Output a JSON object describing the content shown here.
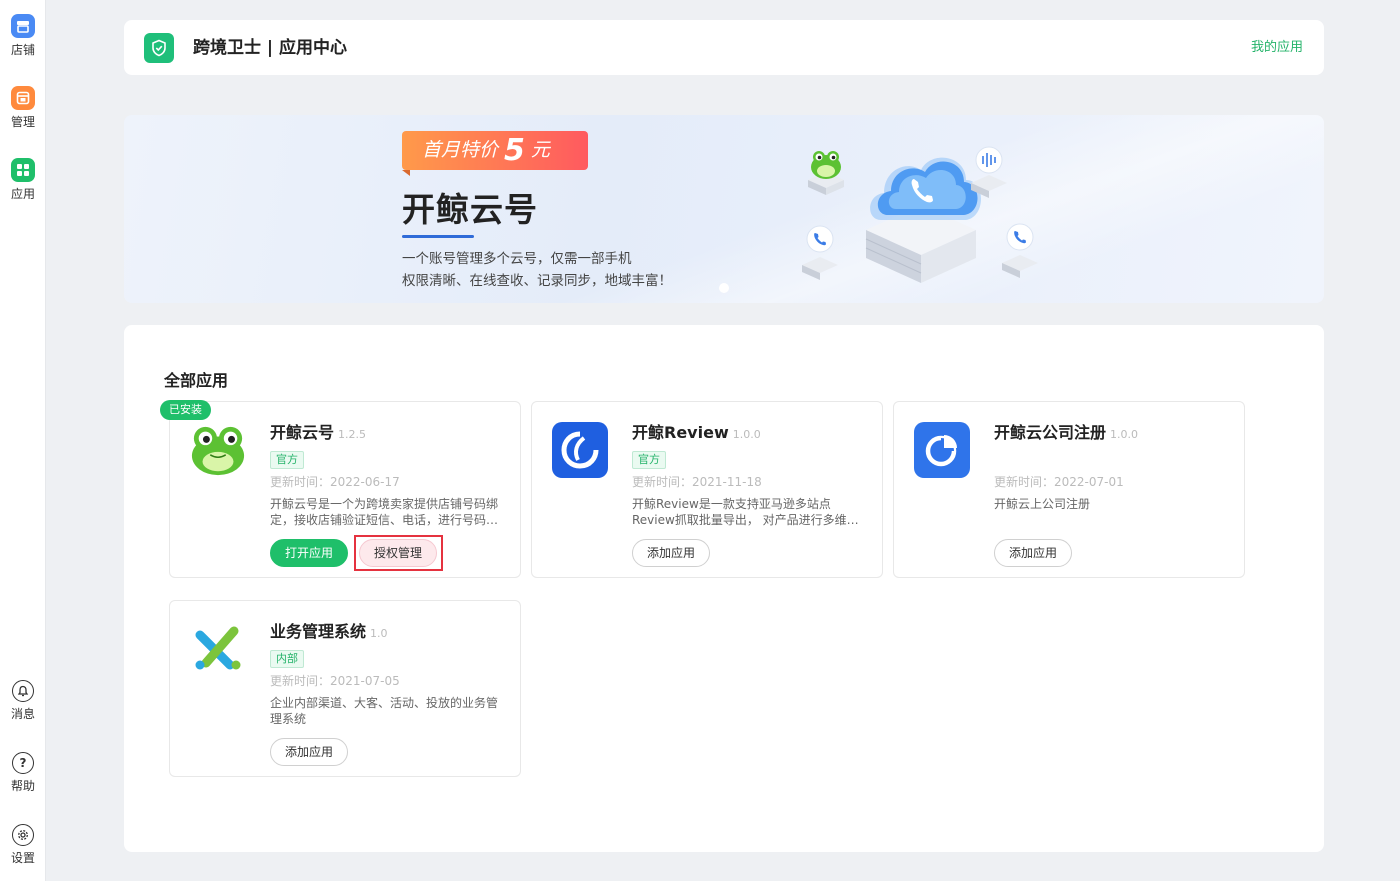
{
  "sidebar": {
    "items": [
      {
        "label": "店铺",
        "icon": "store-icon",
        "color": "#4a8af4"
      },
      {
        "label": "管理",
        "icon": "manage-icon",
        "color": "#ff8a3d"
      },
      {
        "label": "应用",
        "icon": "apps-icon",
        "color": "#1fbf6a"
      }
    ],
    "bottom_items": [
      {
        "label": "消息",
        "icon": "bell-icon"
      },
      {
        "label": "帮助",
        "icon": "help-icon"
      },
      {
        "label": "设置",
        "icon": "gear-icon"
      }
    ]
  },
  "header": {
    "title": "跨境卫士 | 应用中心",
    "my_apps": "我的应用"
  },
  "banner": {
    "promo_prefix": "首月特价",
    "promo_number": "5",
    "promo_suffix": "元",
    "title": "开鲸云号",
    "line1": "一个账号管理多个云号，仅需一部手机",
    "line2": "权限清晰、在线查收、记录同步，地域丰富！"
  },
  "apps": {
    "section_title": "全部应用",
    "installed_badge": "已安装",
    "cards": [
      {
        "name": "开鲸云号",
        "version": "1.2.5",
        "tag": "官方",
        "updated": "更新时间：2022-06-17",
        "desc": "开鲸云号是一个为跨境卖家提供店铺号码绑定，接收店铺验证短信、电话，进行号码管理的应用",
        "primary_btn": "打开应用",
        "secondary_btn": "授权管理"
      },
      {
        "name": "开鲸Review",
        "version": "1.0.0",
        "tag": "官方",
        "updated": "更新时间：2021-11-18",
        "desc": "开鲸Review是一款支持亚马逊多站点Review抓取批量导出， 对产品进行多维度分析的应用",
        "btn": "添加应用"
      },
      {
        "name": "开鲸云公司注册",
        "version": "1.0.0",
        "updated": "更新时间：2022-07-01",
        "desc": "开鲸云上公司注册",
        "btn": "添加应用"
      },
      {
        "name": "业务管理系统",
        "version": "1.0",
        "tag": "内部",
        "updated": "更新时间：2021-07-05",
        "desc": "企业内部渠道、大客、活动、投放的业务管理系统",
        "btn": "添加应用"
      }
    ]
  },
  "colors": {
    "accent_green": "#1fbf6a",
    "highlight_red": "#e5323f",
    "brand_blue": "#2f6bd8"
  }
}
